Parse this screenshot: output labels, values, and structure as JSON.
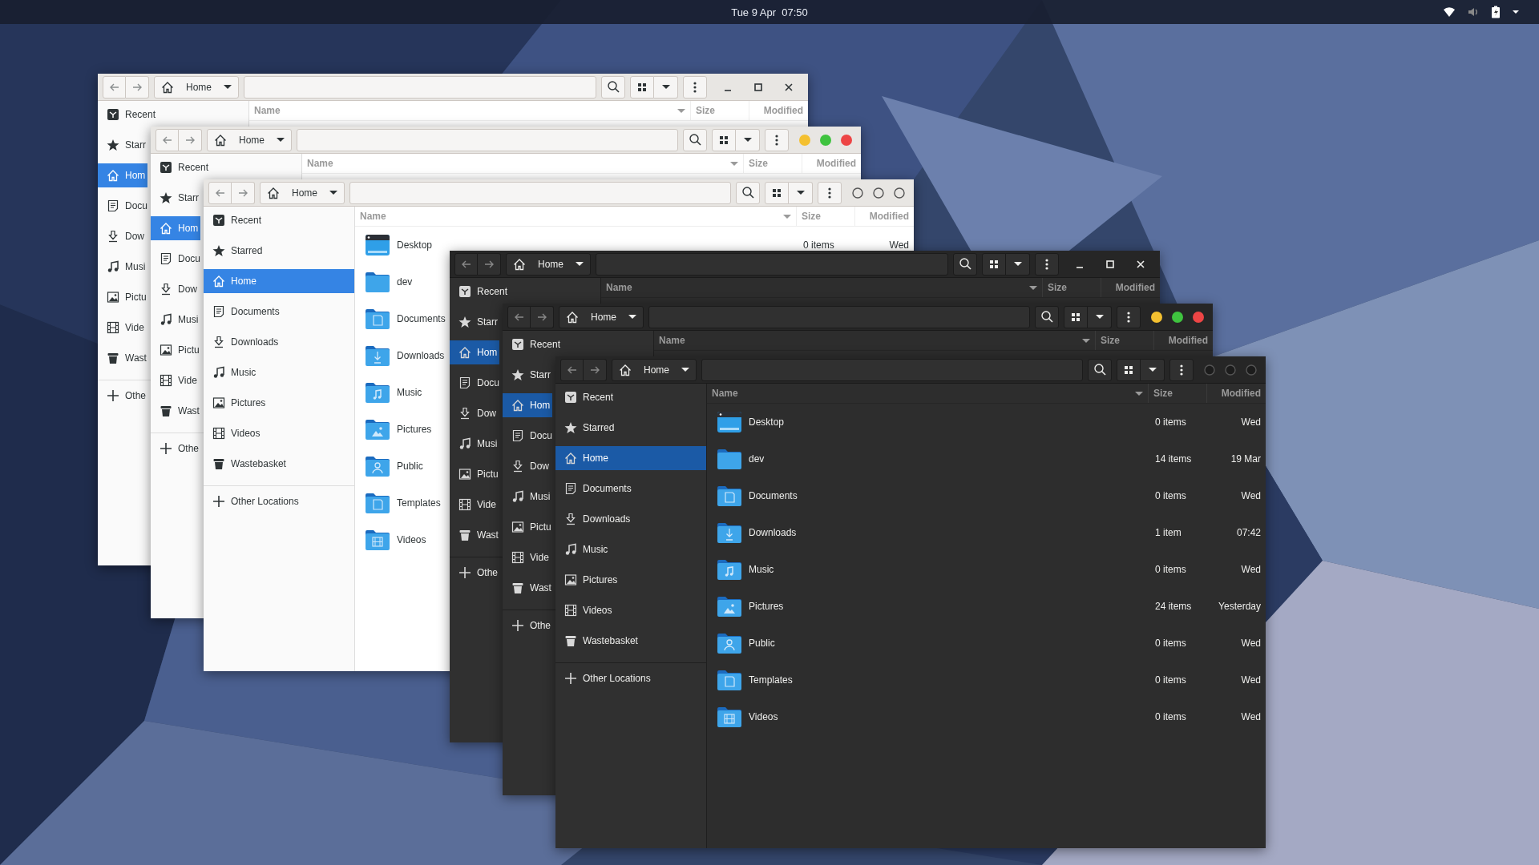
{
  "top_bar": {
    "clock": "Tue 9 Apr  07:50"
  },
  "windows": [
    {
      "kind": "light",
      "window_buttons": {
        "kind": "standard"
      },
      "location": "Home",
      "columns": [
        "Name",
        "Size",
        "Modified"
      ],
      "sidebar": {
        "items": [
          {
            "label": "Recent",
            "selected": false
          },
          {
            "label": "Starr",
            "selected": false
          },
          {
            "label": "Hom",
            "selected": true
          },
          {
            "label": "Docu",
            "selected": false
          },
          {
            "label": "Dow",
            "selected": false
          },
          {
            "label": "Musi",
            "selected": false
          },
          {
            "label": "Pictu",
            "selected": false
          },
          {
            "label": "Vide",
            "selected": false
          },
          {
            "label": "Wast",
            "selected": false
          }
        ],
        "other": "Othe"
      }
    },
    {
      "kind": "light",
      "window_buttons": {
        "kind": "traffic"
      },
      "location": "Home",
      "columns": [
        "Name",
        "Size",
        "Modified"
      ],
      "sidebar": {
        "items": [
          {
            "label": "Recent",
            "selected": false
          },
          {
            "label": "Starr",
            "selected": false
          },
          {
            "label": "Hom",
            "selected": true
          },
          {
            "label": "Docu",
            "selected": false
          },
          {
            "label": "Dow",
            "selected": false
          },
          {
            "label": "Musi",
            "selected": false
          },
          {
            "label": "Pictu",
            "selected": false
          },
          {
            "label": "Vide",
            "selected": false
          },
          {
            "label": "Wast",
            "selected": false
          }
        ],
        "other": "Othe"
      }
    },
    {
      "kind": "light",
      "window_buttons": {
        "kind": "outline"
      },
      "location": "Home",
      "columns": [
        "Name",
        "Size",
        "Modified"
      ],
      "sidebar": {
        "items": [
          {
            "label": "Recent",
            "selected": false
          },
          {
            "label": "Starred",
            "selected": false
          },
          {
            "label": "Home",
            "selected": true
          },
          {
            "label": "Documents",
            "selected": false
          },
          {
            "label": "Downloads",
            "selected": false
          },
          {
            "label": "Music",
            "selected": false
          },
          {
            "label": "Pictures",
            "selected": false
          },
          {
            "label": "Videos",
            "selected": false
          },
          {
            "label": "Wastebasket",
            "selected": false
          }
        ],
        "other": "Other Locations"
      },
      "files": [
        {
          "name": "Desktop",
          "size": "0 items",
          "modified": "Wed"
        },
        {
          "name": "dev"
        },
        {
          "name": "Documents"
        },
        {
          "name": "Downloads"
        },
        {
          "name": "Music"
        },
        {
          "name": "Pictures"
        },
        {
          "name": "Public"
        },
        {
          "name": "Templates"
        },
        {
          "name": "Videos"
        }
      ]
    },
    {
      "kind": "dark",
      "window_buttons": {
        "kind": "standard"
      },
      "location": "Home",
      "columns": [
        "Name",
        "Size",
        "Modified"
      ],
      "sidebar": {
        "items": [
          {
            "label": "Recent",
            "selected": false
          },
          {
            "label": "Starr",
            "selected": false
          },
          {
            "label": "Hom",
            "selected": true
          },
          {
            "label": "Docu",
            "selected": false
          },
          {
            "label": "Dow",
            "selected": false
          },
          {
            "label": "Musi",
            "selected": false
          },
          {
            "label": "Pictu",
            "selected": false
          },
          {
            "label": "Vide",
            "selected": false
          },
          {
            "label": "Wast",
            "selected": false
          }
        ],
        "other": "Othe"
      }
    },
    {
      "kind": "dark",
      "window_buttons": {
        "kind": "traffic"
      },
      "location": "Home",
      "columns": [
        "Name",
        "Size",
        "Modified"
      ],
      "sidebar": {
        "items": [
          {
            "label": "Recent",
            "selected": false
          },
          {
            "label": "Starr",
            "selected": false
          },
          {
            "label": "Hom",
            "selected": true
          },
          {
            "label": "Docu",
            "selected": false
          },
          {
            "label": "Dow",
            "selected": false
          },
          {
            "label": "Musi",
            "selected": false
          },
          {
            "label": "Pictu",
            "selected": false
          },
          {
            "label": "Vide",
            "selected": false
          },
          {
            "label": "Wast",
            "selected": false
          }
        ],
        "other": "Othe"
      }
    },
    {
      "kind": "dark",
      "window_buttons": {
        "kind": "outline"
      },
      "location": "Home",
      "columns": [
        "Name",
        "Size",
        "Modified"
      ],
      "sidebar": {
        "items": [
          {
            "label": "Recent",
            "selected": false
          },
          {
            "label": "Starred",
            "selected": false
          },
          {
            "label": "Home",
            "selected": true
          },
          {
            "label": "Documents",
            "selected": false
          },
          {
            "label": "Downloads",
            "selected": false
          },
          {
            "label": "Music",
            "selected": false
          },
          {
            "label": "Pictures",
            "selected": false
          },
          {
            "label": "Videos",
            "selected": false
          },
          {
            "label": "Wastebasket",
            "selected": false
          }
        ],
        "other": "Other Locations"
      },
      "files": [
        {
          "name": "Desktop",
          "size": "0 items",
          "modified": "Wed"
        },
        {
          "name": "dev",
          "size": "14 items",
          "modified": "19 Mar"
        },
        {
          "name": "Documents",
          "size": "0 items",
          "modified": "Wed"
        },
        {
          "name": "Downloads",
          "size": "1 item",
          "modified": "07:42"
        },
        {
          "name": "Music",
          "size": "0 items",
          "modified": "Wed"
        },
        {
          "name": "Pictures",
          "size": "24 items",
          "modified": "Yesterday"
        },
        {
          "name": "Public",
          "size": "0 items",
          "modified": "Wed"
        },
        {
          "name": "Templates",
          "size": "0 items",
          "modified": "Wed"
        },
        {
          "name": "Videos",
          "size": "0 items",
          "modified": "Wed"
        }
      ]
    }
  ]
}
